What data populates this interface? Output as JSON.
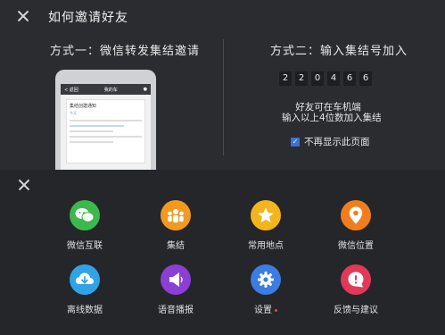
{
  "dialog": {
    "title": "如何邀请好友",
    "method1": "方式一：微信转发集结邀请",
    "method2": "方式二：输入集结号加入",
    "phone": {
      "back": "< 返回",
      "title": "我的车",
      "card_title": "集结创建通知",
      "card_sub": "今天"
    },
    "code_digits": [
      "2",
      "2",
      "0",
      "4",
      "6",
      "6"
    ],
    "hint_line1": "好友可在车机端",
    "hint_line2": "输入以上4位数加入集结",
    "checkbox_label": "不再显示此页面"
  },
  "apps": [
    {
      "label": "微信互联",
      "color": "#3cb94b",
      "icon": "wechat-icon"
    },
    {
      "label": "集结",
      "color": "#f19a22",
      "icon": "group-icon"
    },
    {
      "label": "常用地点",
      "color": "#f3b51d",
      "icon": "star-icon"
    },
    {
      "label": "微信位置",
      "color": "#f07e1f",
      "icon": "location-pin-icon"
    },
    {
      "label": "离线数据",
      "color": "#2fa3e6",
      "icon": "download-icon"
    },
    {
      "label": "语音播报",
      "color": "#8b3fd3",
      "icon": "speaker-icon"
    },
    {
      "label": "设置",
      "color": "#3b7de0",
      "icon": "gear-icon"
    },
    {
      "label": "反馈与建议",
      "color": "#e2395a",
      "icon": "feedback-icon"
    }
  ],
  "colors": {
    "accent": "#3d6fd6",
    "badge": "#e34b4b"
  }
}
